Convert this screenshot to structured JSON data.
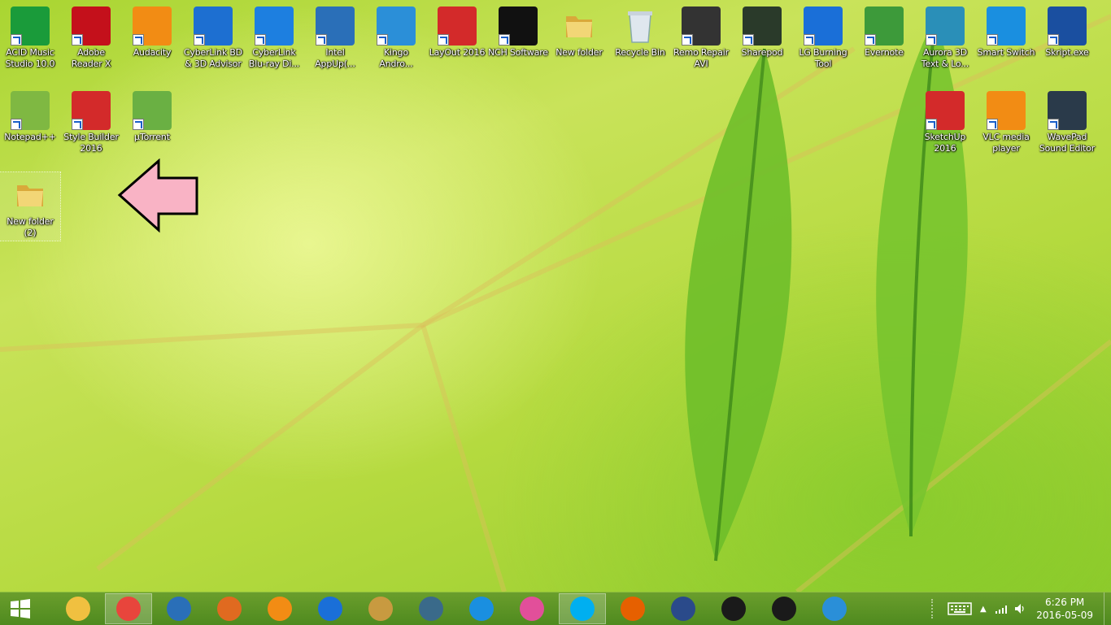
{
  "desktop": {
    "icons": [
      {
        "label": "ACID Music Studio 10.0",
        "icon": "acid-music-icon",
        "color": "#1a9b3a"
      },
      {
        "label": "Adobe Reader X",
        "icon": "adobe-reader-icon",
        "color": "#c4101b"
      },
      {
        "label": "Audacity",
        "icon": "audacity-icon",
        "color": "#f28c14"
      },
      {
        "label": "CyberLink BD & 3D Advisor",
        "icon": "cyberlink-bd-icon",
        "color": "#1d6fd1"
      },
      {
        "label": "CyberLink Blu-ray Di...",
        "icon": "cyberlink-bluray-icon",
        "color": "#1d7fe0"
      },
      {
        "label": "Intel AppUp(...",
        "icon": "intel-appup-icon",
        "color": "#2a6fb8"
      },
      {
        "label": "Kingo Andro...",
        "icon": "kingo-android-icon",
        "color": "#2b8fd8"
      },
      {
        "label": "LayOut 2016",
        "icon": "layout-icon",
        "color": "#d32a2a"
      },
      {
        "label": "NCH Software",
        "icon": "nch-software-icon",
        "color": "#111111"
      },
      {
        "label": "New folder",
        "icon": "folder-icon",
        "color": "#e8c55a"
      },
      {
        "label": "Recycle Bin",
        "icon": "recycle-bin-icon",
        "color": "#b8c8d8"
      },
      {
        "label": "Remo Repair AVI",
        "icon": "remo-repair-icon",
        "color": "#333333"
      },
      {
        "label": "Sharepod",
        "icon": "sharepod-icon",
        "color": "#2a3a2a"
      },
      {
        "label": "LG Burning Tool",
        "icon": "lg-burning-icon",
        "color": "#1a6fd8"
      },
      {
        "label": "Evernote",
        "icon": "evernote-icon",
        "color": "#3d9a3a"
      },
      {
        "label": "Aurora 3D Text & Lo...",
        "icon": "aurora-3d-icon",
        "color": "#2a8fb8"
      },
      {
        "label": "Smart Switch",
        "icon": "smart-switch-icon",
        "color": "#1a8fe0"
      },
      {
        "label": "Skript.exe",
        "icon": "skript-icon",
        "color": "#1a4fa0"
      },
      {
        "label": "Notepad++",
        "icon": "notepad-plus-icon",
        "color": "#7fb842"
      },
      {
        "label": "Style Builder 2016",
        "icon": "style-builder-icon",
        "color": "#d32a2a"
      },
      {
        "label": "µTorrent",
        "icon": "utorrent-icon",
        "color": "#6ab043"
      },
      {
        "label": "SketchUp 2016",
        "icon": "sketchup-icon",
        "color": "#d32a2a"
      },
      {
        "label": "VLC media player",
        "icon": "vlc-icon",
        "color": "#f28c14"
      },
      {
        "label": "WavePad Sound Editor",
        "icon": "wavepad-icon",
        "color": "#2a3a4a"
      },
      {
        "label": "New folder (2)",
        "icon": "folder-icon",
        "color": "#e8c55a"
      }
    ],
    "pointer_arrow_color": "#f9b3c5"
  },
  "taskbar": {
    "start": "windows-start-icon",
    "apps": [
      {
        "name": "file-explorer-icon",
        "color": "#f0c040"
      },
      {
        "name": "chrome-icon",
        "color": "#e8453c",
        "active": true
      },
      {
        "name": "wondershare-icon",
        "color": "#2a6fb8"
      },
      {
        "name": "app-puzzle-icon",
        "color": "#e06a20"
      },
      {
        "name": "video-player-icon",
        "color": "#f28c14"
      },
      {
        "name": "malwarebytes-icon",
        "color": "#1a6fd8"
      },
      {
        "name": "courthouse-icon",
        "color": "#c89a40"
      },
      {
        "name": "film-icon",
        "color": "#3a6a8a"
      },
      {
        "name": "qq-icon",
        "color": "#1a8fe0"
      },
      {
        "name": "itunes-icon",
        "color": "#e24f9a"
      },
      {
        "name": "skype-icon",
        "color": "#00aff0",
        "active": true
      },
      {
        "name": "firefox-icon",
        "color": "#e66000"
      },
      {
        "name": "remote-desktop-icon",
        "color": "#2a4a8a"
      },
      {
        "name": "hypercam-icon",
        "color": "#1a1a1a"
      },
      {
        "name": "media-play-icon",
        "color": "#1a1a1a"
      },
      {
        "name": "safari-icon",
        "color": "#2a8fd8"
      }
    ],
    "tray": {
      "keyboard": "keyboard-icon",
      "clock_time": "6:26 PM",
      "clock_date": "2016-05-09"
    }
  }
}
